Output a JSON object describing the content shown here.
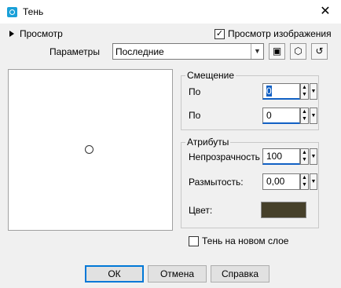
{
  "window": {
    "title": "Тень"
  },
  "preview": {
    "toggle_label": "Просмотр",
    "checkbox_label": "Просмотр изображения",
    "checkbox_checked": true
  },
  "params": {
    "label": "Параметры",
    "value": "Последние"
  },
  "offset": {
    "title": "Смещение",
    "x_label": "По",
    "x_value": "0",
    "y_label": "По",
    "y_value": "0"
  },
  "attributes": {
    "title": "Атрибуты",
    "opacity_label": "Непрозрачность",
    "opacity_value": "100",
    "blur_label": "Размытость:",
    "blur_value": "0,00",
    "color_label": "Цвет:",
    "color": "#46402a"
  },
  "new_layer": {
    "label": "Тень на новом слое",
    "checked": false
  },
  "buttons": {
    "ok": "ОК",
    "cancel": "Отмена",
    "help": "Справка"
  },
  "icons": {
    "app": "paint-app-icon",
    "save": "save-icon",
    "cube": "cube-icon",
    "reset": "reset-icon"
  }
}
